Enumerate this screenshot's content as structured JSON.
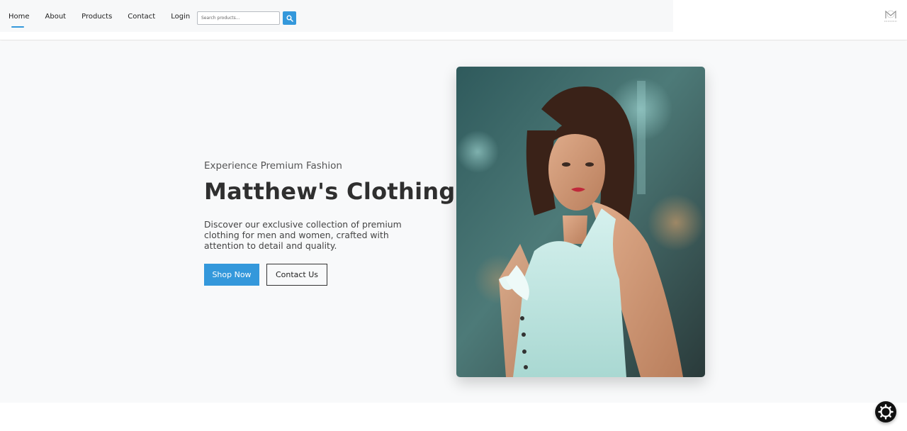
{
  "nav": {
    "items": [
      {
        "label": "Home"
      },
      {
        "label": "About"
      },
      {
        "label": "Products"
      },
      {
        "label": "Contact"
      },
      {
        "label": "Login"
      }
    ]
  },
  "search": {
    "placeholder": "Search products...",
    "button_icon": "search-icon"
  },
  "logo": {
    "icon": "brand-logo-icon"
  },
  "hero": {
    "tagline": "Experience Premium Fashion",
    "title": "Matthew's Clothing",
    "description": "Discover our exclusive collection of premium clothing for men and women, crafted with attention to detail and quality.",
    "primary_button": "Shop Now",
    "secondary_button": "Contact Us",
    "image": "model-portrait-image"
  },
  "fab": {
    "icon": "gear-icon"
  },
  "colors": {
    "accent": "#3498db",
    "hero_bg": "#f8f9fa",
    "title": "#2f2f2f"
  }
}
